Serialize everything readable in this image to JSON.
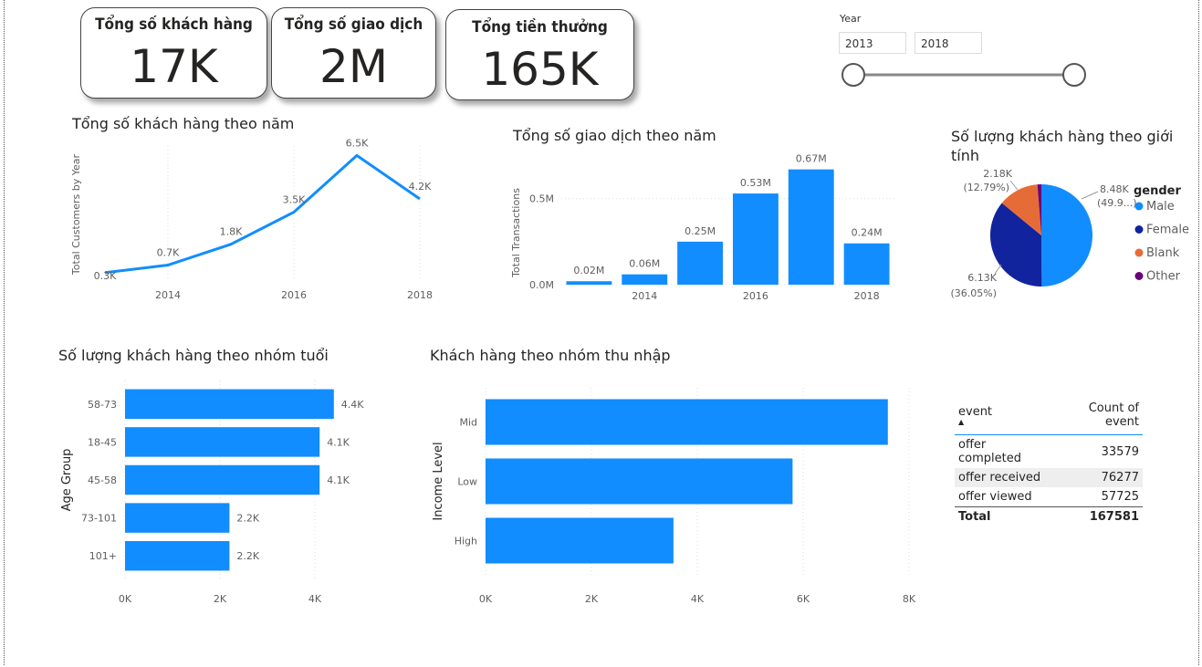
{
  "kpis": [
    {
      "title": "Tổng số khách hàng",
      "value": "17K"
    },
    {
      "title": "Tổng số giao dịch",
      "value": "2M"
    },
    {
      "title": "Tổng tiền thưởng",
      "value": "165K"
    }
  ],
  "slicer": {
    "label": "Year",
    "start": "2013",
    "end": "2018"
  },
  "colors": {
    "accent": "#118dff",
    "male": "#118dff",
    "female": "#12239e",
    "blank": "#e66c37",
    "other": "#6b007b"
  },
  "chart_data": [
    {
      "type": "line",
      "title": "Tổng số khách hàng theo năm",
      "ylabel": "Total Customers by Year",
      "x": [
        2013,
        2014,
        2015,
        2016,
        2017,
        2018
      ],
      "values": [
        0.3,
        0.7,
        1.8,
        3.5,
        6.5,
        4.2
      ],
      "labels": [
        "0.3K",
        "0.7K",
        "1.8K",
        "3.5K",
        "6.5K",
        "4.2K"
      ],
      "xticks": [
        "2014",
        "2016",
        "2018"
      ],
      "ylim": [
        0,
        7
      ]
    },
    {
      "type": "bar",
      "title": "Tổng số giao dịch theo năm",
      "ylabel": "Total Transactions",
      "x": [
        2013,
        2014,
        2015,
        2016,
        2017,
        2018
      ],
      "values": [
        0.02,
        0.06,
        0.25,
        0.53,
        0.67,
        0.24
      ],
      "labels": [
        "0.02M",
        "0.06M",
        "0.25M",
        "0.53M",
        "0.67M",
        "0.24M"
      ],
      "xticks": [
        "2014",
        "2016",
        "2018"
      ],
      "yticks": [
        "0.0M",
        "0.5M"
      ],
      "ylim": [
        0,
        0.7
      ]
    },
    {
      "type": "pie",
      "title": "Số lượng khách hàng theo giới tính",
      "legend_title": "gender",
      "slices": [
        {
          "name": "Male",
          "value": 8.48,
          "label": "8.48K",
          "pct": "(49.9...)"
        },
        {
          "name": "Female",
          "value": 6.13,
          "label": "6.13K",
          "pct": "(36.05%)"
        },
        {
          "name": "Blank",
          "value": 2.18,
          "label": "2.18K",
          "pct": "(12.79%)"
        },
        {
          "name": "Other",
          "value": 0.21,
          "label": "",
          "pct": ""
        }
      ]
    },
    {
      "type": "bar",
      "orientation": "horizontal",
      "title": "Số lượng khách hàng theo nhóm tuổi",
      "ylabel": "Age Group",
      "categories": [
        "58-73",
        "18-45",
        "45-58",
        "73-101",
        "101+"
      ],
      "values": [
        4.4,
        4.1,
        4.1,
        2.2,
        2.2
      ],
      "labels": [
        "4.4K",
        "4.1K",
        "4.1K",
        "2.2K",
        "2.2K"
      ],
      "xticks": [
        "0K",
        "2K",
        "4K"
      ],
      "xlim": [
        0,
        4.5
      ]
    },
    {
      "type": "bar",
      "orientation": "horizontal",
      "title": "Khách hàng theo nhóm thu nhập",
      "ylabel": "Income Level",
      "categories": [
        "Mid",
        "Low",
        "High"
      ],
      "values": [
        7.6,
        5.8,
        3.55
      ],
      "xticks": [
        "0K",
        "2K",
        "4K",
        "6K",
        "8K"
      ],
      "xlim": [
        0,
        8
      ]
    },
    {
      "type": "table",
      "columns": [
        "event",
        "Count of event"
      ],
      "rows": [
        [
          "offer completed",
          "33579"
        ],
        [
          "offer received",
          "76277"
        ],
        [
          "offer viewed",
          "57725"
        ]
      ],
      "total": [
        "Total",
        "167581"
      ]
    }
  ]
}
